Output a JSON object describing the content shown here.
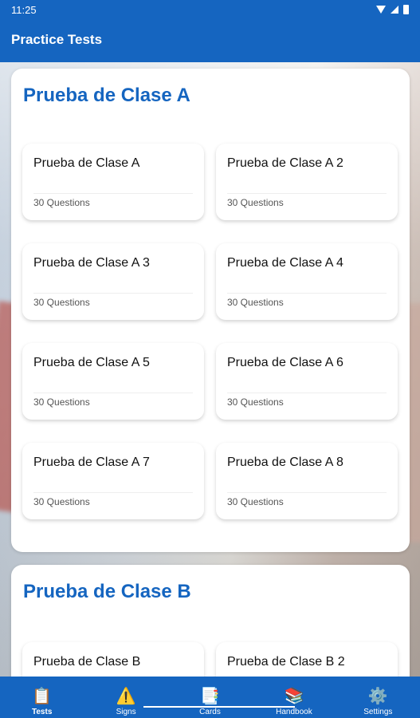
{
  "status_bar": {
    "time": "11:25"
  },
  "app_bar": {
    "title": "Practice Tests"
  },
  "sections": [
    {
      "title": "Prueba de Clase A",
      "tests": [
        {
          "title": "Prueba de Clase A",
          "subtitle": "30 Questions"
        },
        {
          "title": "Prueba de Clase A 2",
          "subtitle": "30 Questions"
        },
        {
          "title": "Prueba de Clase A 3",
          "subtitle": "30 Questions"
        },
        {
          "title": "Prueba de Clase A 4",
          "subtitle": "30 Questions"
        },
        {
          "title": "Prueba de Clase A 5",
          "subtitle": "30 Questions"
        },
        {
          "title": "Prueba de Clase A 6",
          "subtitle": "30 Questions"
        },
        {
          "title": "Prueba de Clase A 7",
          "subtitle": "30 Questions"
        },
        {
          "title": "Prueba de Clase A 8",
          "subtitle": "30 Questions"
        }
      ]
    },
    {
      "title": "Prueba de Clase B",
      "tests": [
        {
          "title": "Prueba de Clase B"
        },
        {
          "title": "Prueba de Clase B 2"
        }
      ]
    }
  ],
  "bottom_nav": [
    {
      "label": "Tests",
      "icon": "clipboard-icon",
      "glyph": "📋",
      "active": true
    },
    {
      "label": "Signs",
      "icon": "warning-sign-icon",
      "glyph": "⚠️",
      "active": false
    },
    {
      "label": "Cards",
      "icon": "flashcards-icon",
      "glyph": "📑",
      "active": false
    },
    {
      "label": "Handbook",
      "icon": "books-icon",
      "glyph": "📚",
      "active": false
    },
    {
      "label": "Settings",
      "icon": "gear-icon",
      "glyph": "⚙️",
      "active": false
    }
  ],
  "colors": {
    "primary": "#1565c0",
    "card_bg": "#ffffff"
  }
}
